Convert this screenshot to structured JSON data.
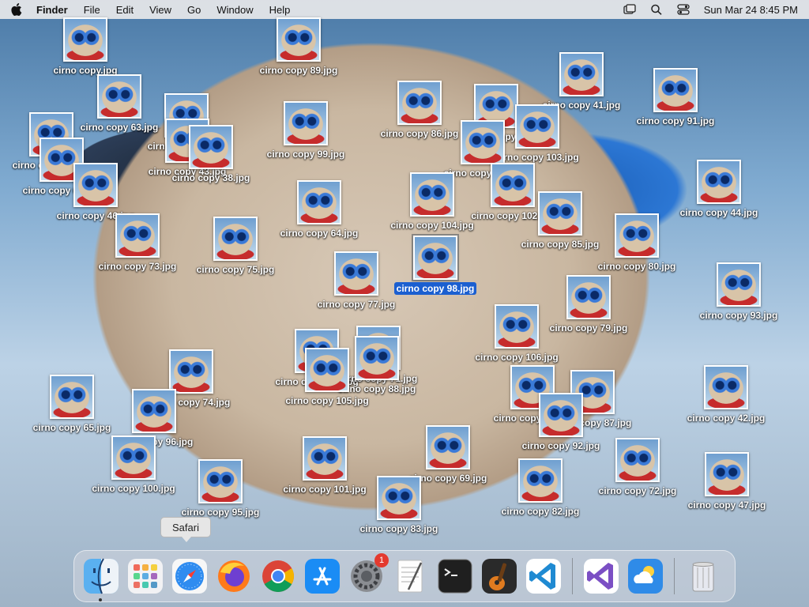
{
  "menubar": {
    "app": "Finder",
    "items": [
      "File",
      "Edit",
      "View",
      "Go",
      "Window",
      "Help"
    ],
    "datetime": "Sun Mar 24  8:45 PM",
    "status_icons": [
      "screen-mirror-icon",
      "spotlight-search-icon",
      "control-center-icon"
    ]
  },
  "desktop": {
    "files": [
      {
        "name": "cirno copy.jpg"
      },
      {
        "name": "cirno copy 89.jpg"
      },
      {
        "name": "cirno copy 63.jpg"
      },
      {
        "name": "cirno copy 41.jpg"
      },
      {
        "name": "cirno copy 91.jpg"
      },
      {
        "name": "cirno copy 86.jpg"
      },
      {
        "name": "cirno copy 6"
      },
      {
        "name": "cirno copy 81.jpg"
      },
      {
        "name": "cirno copy 99.jpg"
      },
      {
        "name": "cirno copy 43.jpg"
      },
      {
        "name": "cirno copy 103.jpg"
      },
      {
        "name": "cirno copy 62.jpg"
      },
      {
        "name": "cirno copy 38.jpg"
      },
      {
        "name": "cirno copy 76.jpg"
      },
      {
        "name": "cirno copy 61.jpg"
      },
      {
        "name": "cirno copy 44.jpg"
      },
      {
        "name": "cirno copy 46.jpg"
      },
      {
        "name": "cirno copy 64.jpg"
      },
      {
        "name": "cirno copy 104.jpg"
      },
      {
        "name": "cirno copy 102.jpg"
      },
      {
        "name": "cirno copy 85.jpg"
      },
      {
        "name": "cirno copy 80.jpg"
      },
      {
        "name": "cirno copy 73.jpg"
      },
      {
        "name": "cirno copy 75.jpg"
      },
      {
        "name": "cirno copy 98.jpg",
        "selected": true
      },
      {
        "name": "cirno copy 77.jpg"
      },
      {
        "name": "cirno copy 79.jpg"
      },
      {
        "name": "cirno copy 93.jpg"
      },
      {
        "name": "cirno copy 106.jpg"
      },
      {
        "name": "cirno copy 107.jpg"
      },
      {
        "name": "cirno copy 71.jpg"
      },
      {
        "name": "cirno copy 88.jpg"
      },
      {
        "name": "cirno copy 74.jpg"
      },
      {
        "name": "cirno copy 105.jpg"
      },
      {
        "name": "cirno copy 94.jpg"
      },
      {
        "name": "cirno copy 87.jpg"
      },
      {
        "name": "cirno copy 42.jpg"
      },
      {
        "name": "cirno copy 65.jpg"
      },
      {
        "name": "cirno copy 96.jpg"
      },
      {
        "name": "cirno copy 92.jpg"
      },
      {
        "name": "cirno copy 69.jpg"
      },
      {
        "name": "cirno copy 100.jpg"
      },
      {
        "name": "cirno copy 101.jpg"
      },
      {
        "name": "cirno copy 72.jpg"
      },
      {
        "name": "cirno copy 95.jpg"
      },
      {
        "name": "cirno copy 82.jpg"
      },
      {
        "name": "cirno copy 47.jpg"
      },
      {
        "name": "cirno copy 83.jpg"
      }
    ]
  },
  "tooltip": "Safari",
  "dock": {
    "apps": [
      {
        "name": "Finder",
        "icon": "finder-icon",
        "running": true
      },
      {
        "name": "Launchpad",
        "icon": "launchpad-icon"
      },
      {
        "name": "Safari",
        "icon": "safari-icon"
      },
      {
        "name": "Firefox",
        "icon": "firefox-icon"
      },
      {
        "name": "Chrome",
        "icon": "chrome-icon"
      },
      {
        "name": "App Store",
        "icon": "app-store-icon"
      },
      {
        "name": "System Settings",
        "icon": "system-settings-icon",
        "badge": "1"
      },
      {
        "name": "TextEdit",
        "icon": "textedit-icon"
      },
      {
        "name": "Terminal",
        "icon": "terminal-icon"
      },
      {
        "name": "GarageBand",
        "icon": "garageband-icon"
      },
      {
        "name": "VS Code",
        "icon": "vscode-icon"
      },
      {
        "name": "Visual Studio",
        "icon": "visual-studio-icon"
      },
      {
        "name": "Weather",
        "icon": "weather-icon"
      },
      {
        "name": "Trash",
        "icon": "trash-icon"
      }
    ]
  }
}
